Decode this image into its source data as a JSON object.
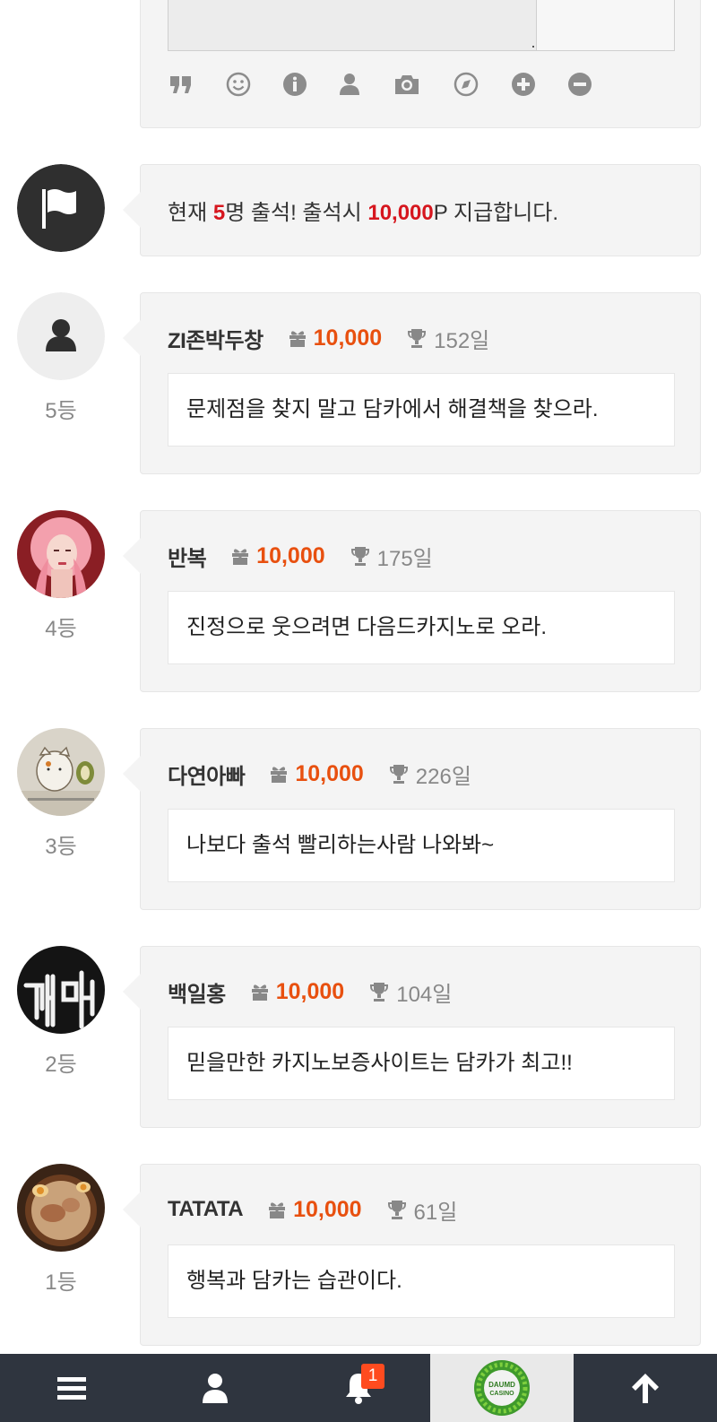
{
  "editor": {
    "tools": [
      "quote-icon",
      "smile-icon",
      "info-icon",
      "user-icon",
      "camera-icon",
      "compass-icon",
      "plus-circle-icon",
      "minus-circle-icon"
    ]
  },
  "notice": {
    "prefix": "현재 ",
    "count": "5",
    "middle": "명 출석! 출석시 ",
    "points": "10,000",
    "suffix": "P 지급합니다."
  },
  "entries": [
    {
      "rank": "5등",
      "name": "ZI존박두창",
      "points": "10,000",
      "days": "152일",
      "message": "문제점을 찾지 말고 담카에서 해결책을 찾으라."
    },
    {
      "rank": "4등",
      "name": "반복",
      "points": "10,000",
      "days": "175일",
      "message": "진정으로 웃으려면 다음드카지노로 오라."
    },
    {
      "rank": "3등",
      "name": "다연아빠",
      "points": "10,000",
      "days": "226일",
      "message": "나보다 출석 빨리하는사람 나와봐~"
    },
    {
      "rank": "2등",
      "name": "백일홍",
      "points": "10,000",
      "days": "104일",
      "message": "믿을만한 카지노보증사이트는 담카가 최고!!"
    },
    {
      "rank": "1등",
      "name": "TATATA",
      "points": "10,000",
      "days": "61일",
      "message": "행복과 담카는 습관이다."
    }
  ],
  "bottom_nav": {
    "items": [
      "menu-icon",
      "user-icon",
      "bell-icon",
      "site-logo",
      "arrow-up-icon"
    ],
    "notification_count": "1",
    "logo_text_1": "DAUMD",
    "logo_text_2": "CASINO"
  },
  "colors": {
    "accent_points": "#e8500f",
    "accent_notice": "#d6161e",
    "bottom_bar": "#2f353f"
  }
}
